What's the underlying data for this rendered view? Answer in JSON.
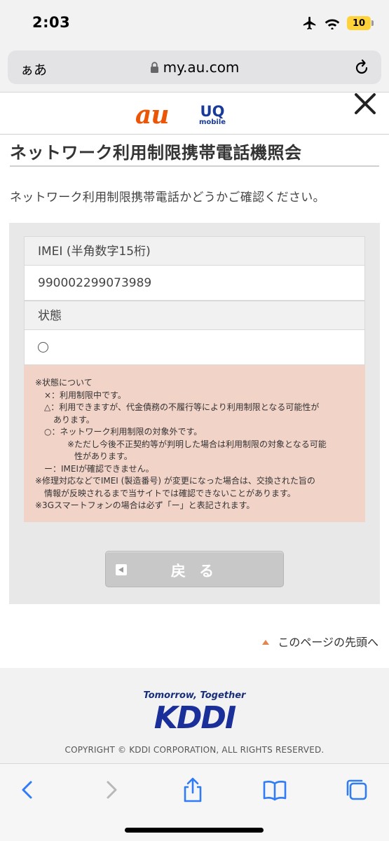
{
  "status_bar": {
    "time": "2:03",
    "battery": "10"
  },
  "browser": {
    "text_size_label": "ぁあ",
    "url": "my.au.com"
  },
  "header": {
    "au_logo": "au",
    "uq_logo": "UQ",
    "uq_logo_sub": "mobile"
  },
  "page": {
    "title": "ネットワーク利用制限携帯電話機照会",
    "intro": "ネットワーク利用制限携帯電話かどうかご確認ください。"
  },
  "form": {
    "imei_label": "IMEI (半角数字15桁)",
    "imei_value": "990002299073989",
    "status_label": "状態"
  },
  "notes": [
    "※状態について",
    "×：利用制限中です。",
    "△：利用できますが、代金債務の不履行等により利用制限となる可能性が",
    "あります。",
    "○：ネットワーク利用制限の対象外です。",
    "※ただし今後不正契約等が判明した場合は利用制限の対象となる可能",
    "性があります。",
    "ー：IMEIが確認できません。",
    "※修理対応などでIMEI (製造番号) が変更になった場合は、交換された旨の",
    "情報が反映されるまで当サイトでは確認できないことがあります。",
    "※3Gスマートフォンの場合は必ず「ー」と表記されます。"
  ],
  "back_button": "戻 る",
  "page_top_link": "このページの先頭へ",
  "footer": {
    "tagline": "Tomorrow, Together",
    "logo": "KDDI",
    "copyright": "COPYRIGHT © KDDI CORPORATION, ALL RIGHTS RESERVED."
  },
  "colors": {
    "au_orange": "#eb5505",
    "kddi_blue": "#1a2f9a",
    "notes_bg": "#f2d3c8",
    "ios_blue": "#2f7cf6"
  },
  "icons": [
    "airplane-icon",
    "wifi-icon",
    "lock-icon",
    "reload-icon",
    "close-icon",
    "back-nav-icon",
    "forward-nav-icon",
    "share-icon",
    "bookmarks-icon",
    "tabs-icon"
  ]
}
